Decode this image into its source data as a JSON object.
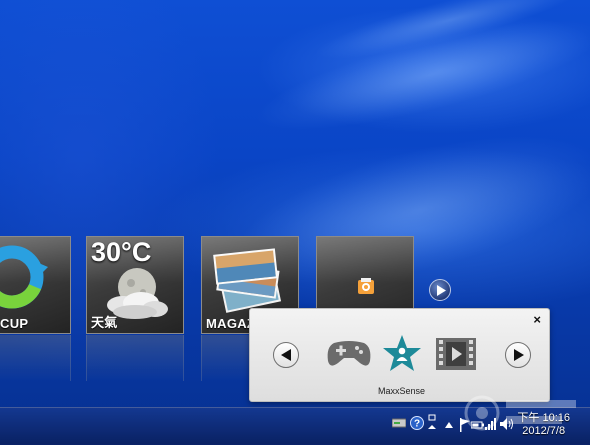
{
  "tiles": [
    {
      "label": "CUP"
    },
    {
      "label": "天氣",
      "temperature": "30°C"
    },
    {
      "label": "MAGAZ"
    },
    {
      "label": ""
    }
  ],
  "panel": {
    "label": "MaxxSense",
    "close_label": "×"
  },
  "taskbar": {
    "clock_time": "下午 10:16",
    "clock_date": "2012/7/8"
  },
  "colors": {
    "desktop": "#0a45c6",
    "tile_bg": "#3b3b3b",
    "panel_bg": "#ececec",
    "teal_icon": "#1d8a99"
  }
}
